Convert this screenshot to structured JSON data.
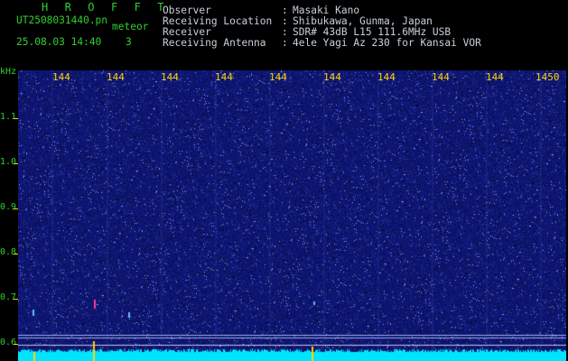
{
  "header": {
    "brand": "H R O F F T",
    "filename": "UT2508031440.pn",
    "type_label": "meteor",
    "date_time": "25.08.03 14:40",
    "count": "3"
  },
  "info": [
    {
      "label": "Observer",
      "value": "Masaki Kano"
    },
    {
      "label": "Receiving Location",
      "value": "Shibukawa, Gunma, Japan"
    },
    {
      "label": "Receiver",
      "value": "SDR# 43dB L15 111.6MHz USB"
    },
    {
      "label": "Receiving Antenna",
      "value": "4ele Yagi Az 230 for Kansai VOR"
    }
  ],
  "separator": ":",
  "y_axis": {
    "unit": "kHz",
    "labels": [
      "1.1",
      "1.0",
      "0.9",
      "0.8",
      "0.7",
      "0.6"
    ]
  },
  "x_axis": {
    "labels": [
      "144",
      "144",
      "144",
      "144",
      "144",
      "144",
      "144",
      "144",
      "144",
      "1450"
    ]
  },
  "colors": {
    "background": "#000000",
    "spectrogram_base": "#0f1a6a",
    "tick_yellow": "#ffd400",
    "label_green": "#31d02f",
    "text_grey": "#c8d0dc",
    "trace_cyan": "#00e5ff",
    "meteor_magenta": "#ff3ca0"
  }
}
